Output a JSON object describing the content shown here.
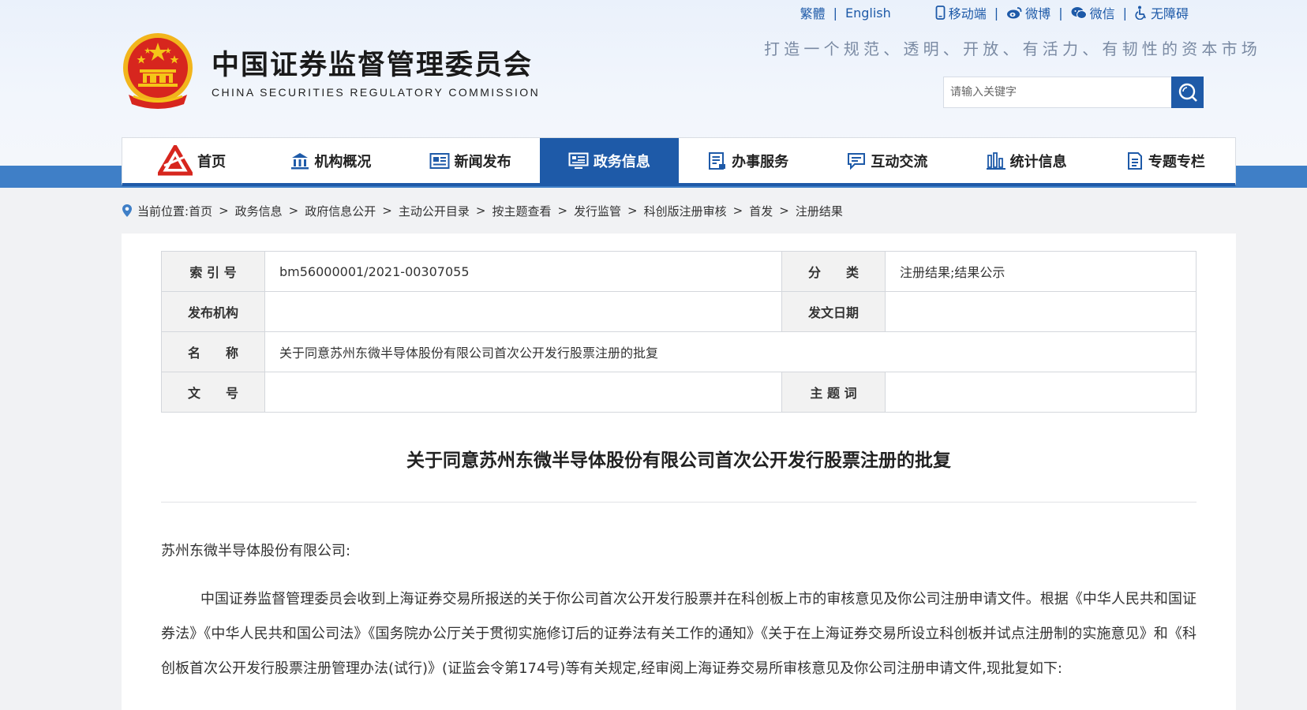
{
  "header": {
    "title_cn": "中国证券监督管理委员会",
    "title_en": "CHINA SECURITIES REGULATORY COMMISSION",
    "slogan": "打造一个规范、透明、开放、有活力、有韧性的资本市场",
    "top_links": {
      "traditional": "繁體",
      "english": "English",
      "mobile": "移动端",
      "weibo": "微博",
      "wechat": "微信",
      "accessibility": "无障碍"
    },
    "search": {
      "placeholder": "请输入关键字"
    }
  },
  "nav": {
    "items": [
      {
        "label": "首页",
        "icon": "csrc-logo-icon"
      },
      {
        "label": "机构概况",
        "icon": "building-icon"
      },
      {
        "label": "新闻发布",
        "icon": "newspaper-icon"
      },
      {
        "label": "政务信息",
        "icon": "monitor-icon",
        "active": true
      },
      {
        "label": "办事服务",
        "icon": "document-list-icon"
      },
      {
        "label": "互动交流",
        "icon": "chat-icon"
      },
      {
        "label": "统计信息",
        "icon": "bar-chart-icon"
      },
      {
        "label": "专题专栏",
        "icon": "file-icon"
      }
    ]
  },
  "breadcrumb": {
    "prefix": "当前位置:",
    "items": [
      "首页",
      "政务信息",
      "政府信息公开",
      "主动公开目录",
      "按主题查看",
      "发行监管",
      "科创版注册审核",
      "首发",
      "注册结果"
    ]
  },
  "meta": {
    "index_label": "索 引 号",
    "index_value": "bm56000001/2021-00307055",
    "category_label": "分　　类",
    "category_value": "注册结果;结果公示",
    "publisher_label": "发布机构",
    "publisher_value": "",
    "date_label": "发文日期",
    "date_value": "",
    "name_label": "名　　称",
    "name_value": "关于同意苏州东微半导体股份有限公司首次公开发行股票注册的批复",
    "docno_label": "文　　号",
    "docno_value": "",
    "keywords_label": "主 题 词",
    "keywords_value": ""
  },
  "article": {
    "title": "关于同意苏州东微半导体股份有限公司首次公开发行股票注册的批复",
    "addressee": "苏州东微半导体股份有限公司:",
    "paragraph": "中国证券监督管理委员会收到上海证券交易所报送的关于你公司首次公开发行股票并在科创板上市的审核意见及你公司注册申请文件。根据《中华人民共和国证券法》《中华人民共和国公司法》《国务院办公厅关于贯彻实施修订后的证券法有关工作的通知》《关于在上海证券交易所设立科创板并试点注册制的实施意见》和《科创板首次公开发行股票注册管理办法(试行)》(证监会令第174号)等有关规定,经审阅上海证券交易所审核意见及你公司注册申请文件,现批复如下:"
  },
  "colors": {
    "brand_blue": "#1e5aa8",
    "band_blue": "#3f7fc7",
    "emblem_red": "#d7261e",
    "emblem_gold": "#f5c518"
  }
}
